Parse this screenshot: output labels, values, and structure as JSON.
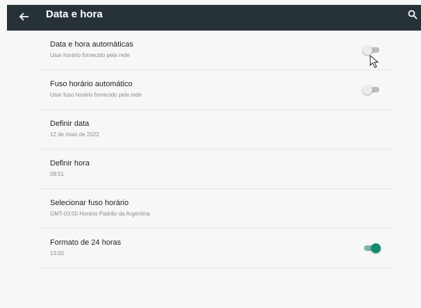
{
  "app_bar": {
    "title": "Data e hora",
    "back_icon": "arrow-left-icon",
    "search_icon": "search-icon"
  },
  "settings": [
    {
      "title": "Data e hora automáticas",
      "summary": "Usar horário fornecido pela rede",
      "toggle": false
    },
    {
      "title": "Fuso horário automático",
      "summary": "Usar fuso horário fornecido pela rede",
      "toggle": false
    },
    {
      "title": "Definir data",
      "summary": "12 de maio de 2022"
    },
    {
      "title": "Definir hora",
      "summary": "08:51"
    },
    {
      "title": "Selecionar fuso horário",
      "summary": "GMT-03:00 Horário Padrão da Argentina"
    },
    {
      "title": "Formato de 24 horas",
      "summary": "13:00",
      "toggle": true
    }
  ],
  "colors": {
    "app_bar": "#263238",
    "accent": "#138a6f"
  }
}
